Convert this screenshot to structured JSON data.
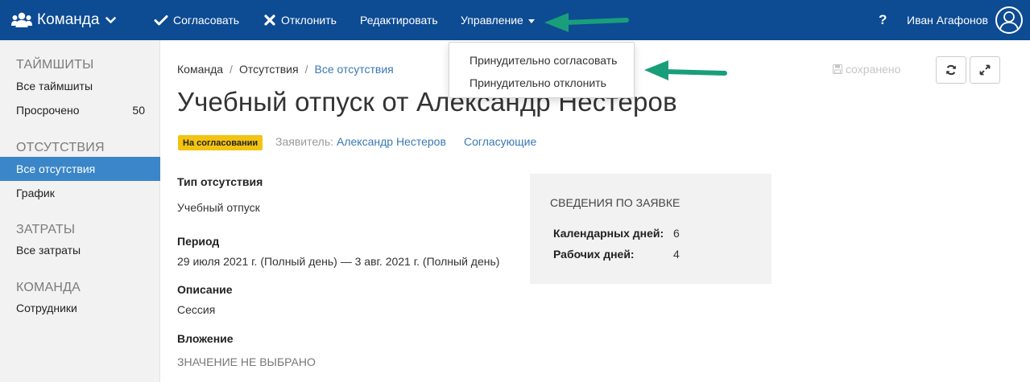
{
  "navbar": {
    "brand": "Команда",
    "approve": "Согласовать",
    "reject": "Отклонить",
    "edit": "Редактировать",
    "manage": "Управление",
    "help": "?",
    "user": "Иван Агафонов",
    "bg_color": "#0d4b93"
  },
  "dropdown": {
    "items": [
      "Принудительно согласовать",
      "Принудительно отклонить"
    ]
  },
  "sidebar": {
    "sections": [
      {
        "title": "ТАЙМШИТЫ",
        "items": [
          {
            "label": "Все таймшиты"
          },
          {
            "label": "Просрочено",
            "count": "50"
          }
        ]
      },
      {
        "title": "ОТСУТСТВИЯ",
        "items": [
          {
            "label": "Все отсутствия",
            "active": true
          },
          {
            "label": "График"
          }
        ]
      },
      {
        "title": "ЗАТРАТЫ",
        "items": [
          {
            "label": "Все затраты"
          }
        ]
      },
      {
        "title": "КОМАНДА",
        "items": [
          {
            "label": "Сотрудники"
          }
        ]
      }
    ],
    "active_color": "#3a86c8"
  },
  "breadcrumb": [
    "Команда",
    "Отсутствия",
    "Все отсутствия"
  ],
  "page": {
    "title": "Учебный отпуск от Александр Нестеров",
    "status": "На согласовании",
    "status_color": "#f3c311",
    "applicant_label": "Заявитель:",
    "applicant": "Александр Нестеров",
    "approvers": "Согласующие",
    "saved": "сохранено"
  },
  "fields": {
    "type_label": "Тип отсутствия",
    "type_value": "Учебный отпуск",
    "period_label": "Период",
    "period_value": "29 июля 2021 г. (Полный день) — 3 авг. 2021 г. (Полный день)",
    "description_label": "Описание",
    "description_value": "Сессия",
    "attachment_label": "Вложение",
    "attachment_value": "ЗНАЧЕНИЕ НЕ ВЫБРАНО"
  },
  "info": {
    "title": "СВЕДЕНИЯ ПО ЗАЯВКЕ",
    "calendar_label": "Календарных дней:",
    "calendar_value": "6",
    "work_label": "Рабочих дней:",
    "work_value": "4"
  },
  "icons": {
    "brand": "team-icon",
    "approve": "check-icon",
    "reject": "x-icon",
    "refresh": "refresh-icon",
    "expand": "expand-icon",
    "saved": "save-icon",
    "user": "user-avatar-icon"
  },
  "annotation_color": "#1a9e7a"
}
